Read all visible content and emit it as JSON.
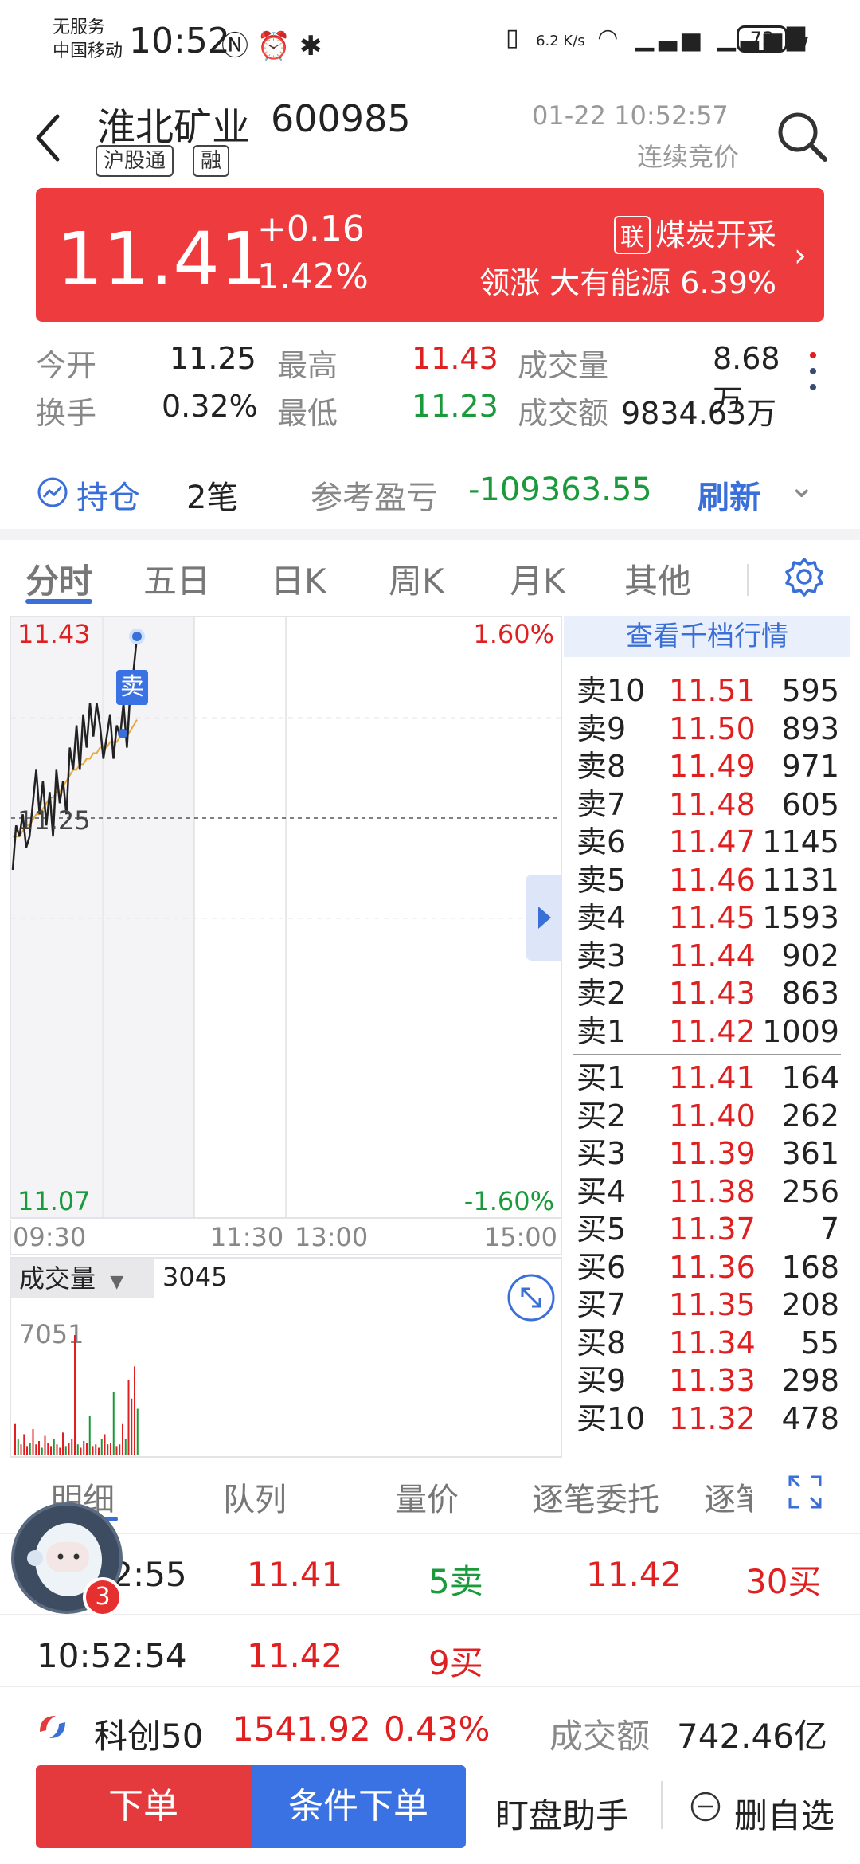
{
  "status_bar": {
    "carrier_line1": "无服务",
    "carrier_line2": "中国移动",
    "time": "10:52",
    "net_speed": "6.2 K/s",
    "battery": "73"
  },
  "header": {
    "name": "淮北矿业",
    "code": "600985",
    "tags": [
      "沪股通",
      "融"
    ],
    "datetime": "01-22 10:52:57",
    "session": "连续竞价"
  },
  "quote": {
    "price": "11.41",
    "change": "+0.16",
    "change_pct": "1.42%",
    "sector_tag": "联",
    "sector": "煤炭开采",
    "leader_label": "领涨",
    "leader_name": "大有能源",
    "leader_pct": "6.39%"
  },
  "stats": [
    {
      "label": "今开",
      "value": "11.25",
      "color": "#222222"
    },
    {
      "label": "最高",
      "value": "11.43",
      "color": "#e02020"
    },
    {
      "label": "成交量",
      "value": "8.68万",
      "color": "#222222"
    },
    {
      "label": "换手",
      "value": "0.32%",
      "color": "#222222"
    },
    {
      "label": "最低",
      "value": "11.23",
      "color": "#1a9a3a"
    },
    {
      "label": "成交额",
      "value": "9834.63万",
      "color": "#222222"
    }
  ],
  "holding": {
    "label": "持仓",
    "count": "2笔",
    "pnl_label": "参考盈亏",
    "pnl_value": "-109363.55",
    "refresh": "刷新"
  },
  "tabs": [
    "分时",
    "五日",
    "日K",
    "周K",
    "月K",
    "其他"
  ],
  "colors": {
    "up": "#e02020",
    "down": "#1a9a3a",
    "accent": "#3b6fd8",
    "banner": "#ed3b3e"
  },
  "chart_data": {
    "type": "line",
    "y_top": "11.43",
    "y_mid": "11.25",
    "y_bottom": "11.07",
    "pct_top": "1.60%",
    "pct_bottom": "-1.60%",
    "x_labels": [
      "09:30",
      "11:30",
      "13:00",
      "15:00"
    ],
    "ylim": [
      11.07,
      11.43
    ],
    "prev_close": 11.25,
    "marker_label": "卖",
    "price_series": [
      11.22,
      11.26,
      11.25,
      11.27,
      11.24,
      11.25,
      11.28,
      11.31,
      11.27,
      11.3,
      11.26,
      11.29,
      11.25,
      11.31,
      11.28,
      11.3,
      11.27,
      11.33,
      11.31,
      11.35,
      11.31,
      11.36,
      11.33,
      11.37,
      11.34,
      11.37,
      11.35,
      11.32,
      11.34,
      11.36,
      11.32,
      11.35,
      11.34,
      11.37,
      11.33,
      11.38,
      11.4,
      11.43
    ],
    "avg_series": [
      11.25,
      11.25,
      11.25,
      11.255,
      11.26,
      11.26,
      11.265,
      11.27,
      11.27,
      11.275,
      11.28,
      11.285,
      11.285,
      11.29,
      11.29,
      11.295,
      11.3,
      11.305,
      11.31,
      11.31,
      11.315,
      11.315,
      11.32,
      11.32,
      11.325,
      11.325,
      11.33,
      11.33,
      11.33,
      11.335,
      11.335,
      11.335,
      11.34,
      11.34,
      11.34,
      11.345,
      11.35,
      11.355
    ],
    "volume": {
      "label": "成交量",
      "current": "3045",
      "max_label": "7051",
      "ymax": 7051,
      "bars": [
        1800,
        900,
        600,
        1200,
        500,
        700,
        1500,
        600,
        800,
        400,
        1100,
        700,
        500,
        900,
        600,
        400,
        1300,
        500,
        700,
        900,
        7051,
        600,
        400,
        800,
        700,
        2300,
        500,
        600,
        400,
        900,
        1200,
        600,
        700,
        3700,
        500,
        600,
        1800,
        900,
        4400,
        3300,
        5200,
        2700
      ]
    }
  },
  "order_book": {
    "header": "查看千档行情",
    "asks": [
      {
        "label": "卖10",
        "price": "11.51",
        "vol": "595"
      },
      {
        "label": "卖9",
        "price": "11.50",
        "vol": "893"
      },
      {
        "label": "卖8",
        "price": "11.49",
        "vol": "971"
      },
      {
        "label": "卖7",
        "price": "11.48",
        "vol": "605"
      },
      {
        "label": "卖6",
        "price": "11.47",
        "vol": "1145"
      },
      {
        "label": "卖5",
        "price": "11.46",
        "vol": "1131"
      },
      {
        "label": "卖4",
        "price": "11.45",
        "vol": "1593"
      },
      {
        "label": "卖3",
        "price": "11.44",
        "vol": "902"
      },
      {
        "label": "卖2",
        "price": "11.43",
        "vol": "863"
      },
      {
        "label": "卖1",
        "price": "11.42",
        "vol": "1009"
      }
    ],
    "bids": [
      {
        "label": "买1",
        "price": "11.41",
        "vol": "164"
      },
      {
        "label": "买2",
        "price": "11.40",
        "vol": "262"
      },
      {
        "label": "买3",
        "price": "11.39",
        "vol": "361"
      },
      {
        "label": "买4",
        "price": "11.38",
        "vol": "256"
      },
      {
        "label": "买5",
        "price": "11.37",
        "vol": "7"
      },
      {
        "label": "买6",
        "price": "11.36",
        "vol": "168"
      },
      {
        "label": "买7",
        "price": "11.35",
        "vol": "208"
      },
      {
        "label": "买8",
        "price": "11.34",
        "vol": "55"
      },
      {
        "label": "买9",
        "price": "11.33",
        "vol": "298"
      },
      {
        "label": "买10",
        "price": "11.32",
        "vol": "478"
      }
    ]
  },
  "detail_tabs": [
    "明细",
    "队列",
    "量价",
    "逐笔委托",
    "逐笔"
  ],
  "trades": [
    {
      "time": "10:52:55",
      "price": "11.41",
      "qty": "5卖",
      "price2": "11.42",
      "qty2": "30买"
    },
    {
      "time": "10:52:54",
      "price": "11.42",
      "qty": "9买",
      "price2": "",
      "qty2": ""
    }
  ],
  "avatar_badge": "3",
  "index_bar": {
    "name": "科创50",
    "value": "1541.92",
    "pct": "0.43%",
    "amount_label": "成交额",
    "amount": "742.46亿"
  },
  "bottom": {
    "order": "下单",
    "cond_order": "条件下单",
    "assistant": "盯盘助手",
    "remove": "删自选"
  }
}
